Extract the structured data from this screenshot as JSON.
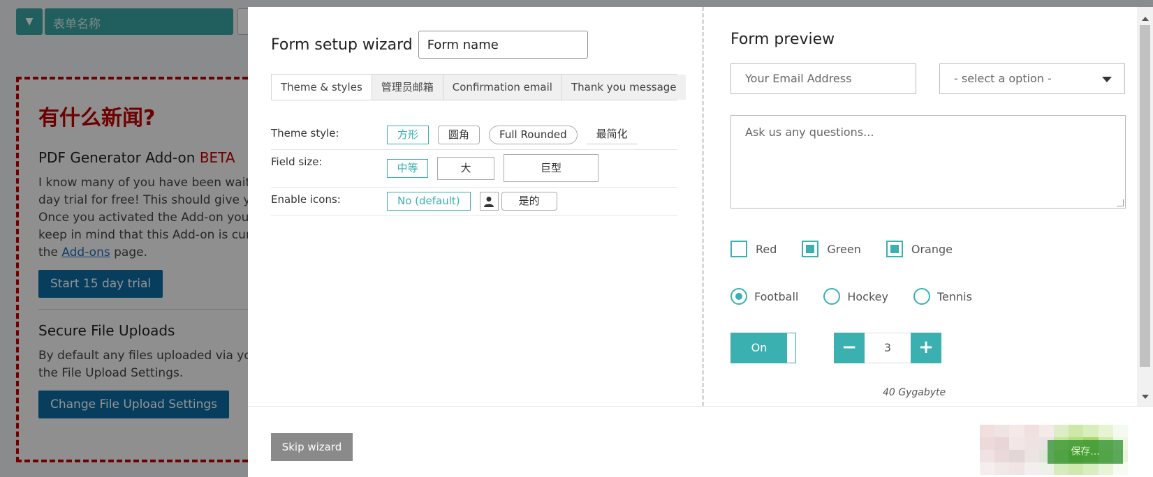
{
  "background": {
    "top_input_placeholder": "表单名称",
    "card": {
      "heading": "有什么新闻?",
      "section1_title": "PDF Generator Add-on",
      "section1_badge": "BETA",
      "section1_lines": [
        "I know many of you have been waiti",
        "day trial for free! This should give yo",
        "Once you activated the Add-on you",
        "keep in mind that this Add-on is curr"
      ],
      "section1_last_prefix": "the",
      "section1_link": "Add-ons",
      "section1_last_suffix": "page.",
      "section1_button": "Start 15 day trial",
      "section2_title": "Secure File Uploads",
      "section2_lines": [
        "By default any files uploaded via you",
        "the File Upload Settings."
      ],
      "section2_button": "Change File Upload Settings"
    }
  },
  "wizard": {
    "title": "Form setup wizard",
    "form_name_value": "Form name",
    "tabs": [
      {
        "label": "Theme & styles"
      },
      {
        "label": "管理员邮箱"
      },
      {
        "label": "Confirmation email"
      },
      {
        "label": "Thank you message"
      }
    ],
    "theme_style": {
      "label": "Theme style:",
      "options": [
        "方形",
        "圆角",
        "Full Rounded",
        "最简化"
      ],
      "selected": "方形"
    },
    "field_size": {
      "label": "Field size:",
      "options": [
        "中等",
        "大",
        "巨型"
      ],
      "selected": "中等"
    },
    "enable_icons": {
      "label": "Enable icons:",
      "options": [
        "No (default)",
        "是的"
      ],
      "selected": "No (default)"
    }
  },
  "preview": {
    "title": "Form preview",
    "email_placeholder": "Your Email Address",
    "select_value": "- select a option -",
    "textarea_placeholder": "Ask us any questions...",
    "checkboxes": [
      {
        "label": "Red",
        "checked": false
      },
      {
        "label": "Green",
        "checked": true
      },
      {
        "label": "Orange",
        "checked": true
      }
    ],
    "radios": [
      {
        "label": "Football",
        "checked": true
      },
      {
        "label": "Hockey",
        "checked": false
      },
      {
        "label": "Tennis",
        "checked": false
      }
    ],
    "toggle_label": "On",
    "stepper_minus": "−",
    "stepper_value": "3",
    "stepper_plus": "+",
    "storage_text": "40 Gygabyte"
  },
  "footer": {
    "skip_label": "Skip wizard",
    "save_label": "保存..."
  },
  "colors": {
    "accent": "#3ab0b0",
    "danger": "#c00000",
    "primary_button": "#0d6aa1"
  }
}
